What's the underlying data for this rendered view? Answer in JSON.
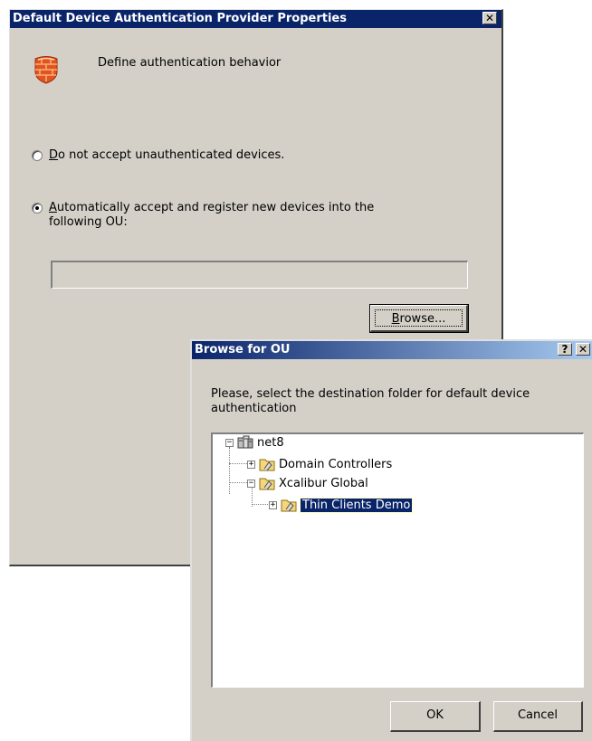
{
  "props_dialog": {
    "title": "Default Device Authentication Provider Properties",
    "close_glyph": "✕",
    "header_icon": "firewall-icon",
    "header_text": "Define authentication behavior",
    "options": [
      {
        "access_key": "D",
        "label_rest": "o not accept unauthenticated devices.",
        "checked": false
      },
      {
        "access_key": "A",
        "label_rest": "utomatically accept and register new devices into the following OU:",
        "checked": true
      }
    ],
    "ou_value": "",
    "browse": {
      "access_key": "B",
      "label_rest": "rowse..."
    }
  },
  "browse_dialog": {
    "title": "Browse for OU",
    "help_glyph": "?",
    "close_glyph": "✕",
    "message": "Please, select the destination folder for default device authentication",
    "tree": [
      {
        "label": "net8",
        "icon": "domain-icon",
        "expander": "−",
        "level": 0
      },
      {
        "label": "Domain Controllers",
        "icon": "ou-folder-icon",
        "expander": "+",
        "level": 1
      },
      {
        "label": "Xcalibur Global",
        "icon": "ou-folder-icon",
        "expander": "−",
        "level": 1
      },
      {
        "label": "Thin Clients Demo",
        "icon": "ou-folder-icon",
        "expander": "+",
        "level": 2,
        "selected": true
      }
    ],
    "ok_label": "OK",
    "cancel_label": "Cancel"
  }
}
